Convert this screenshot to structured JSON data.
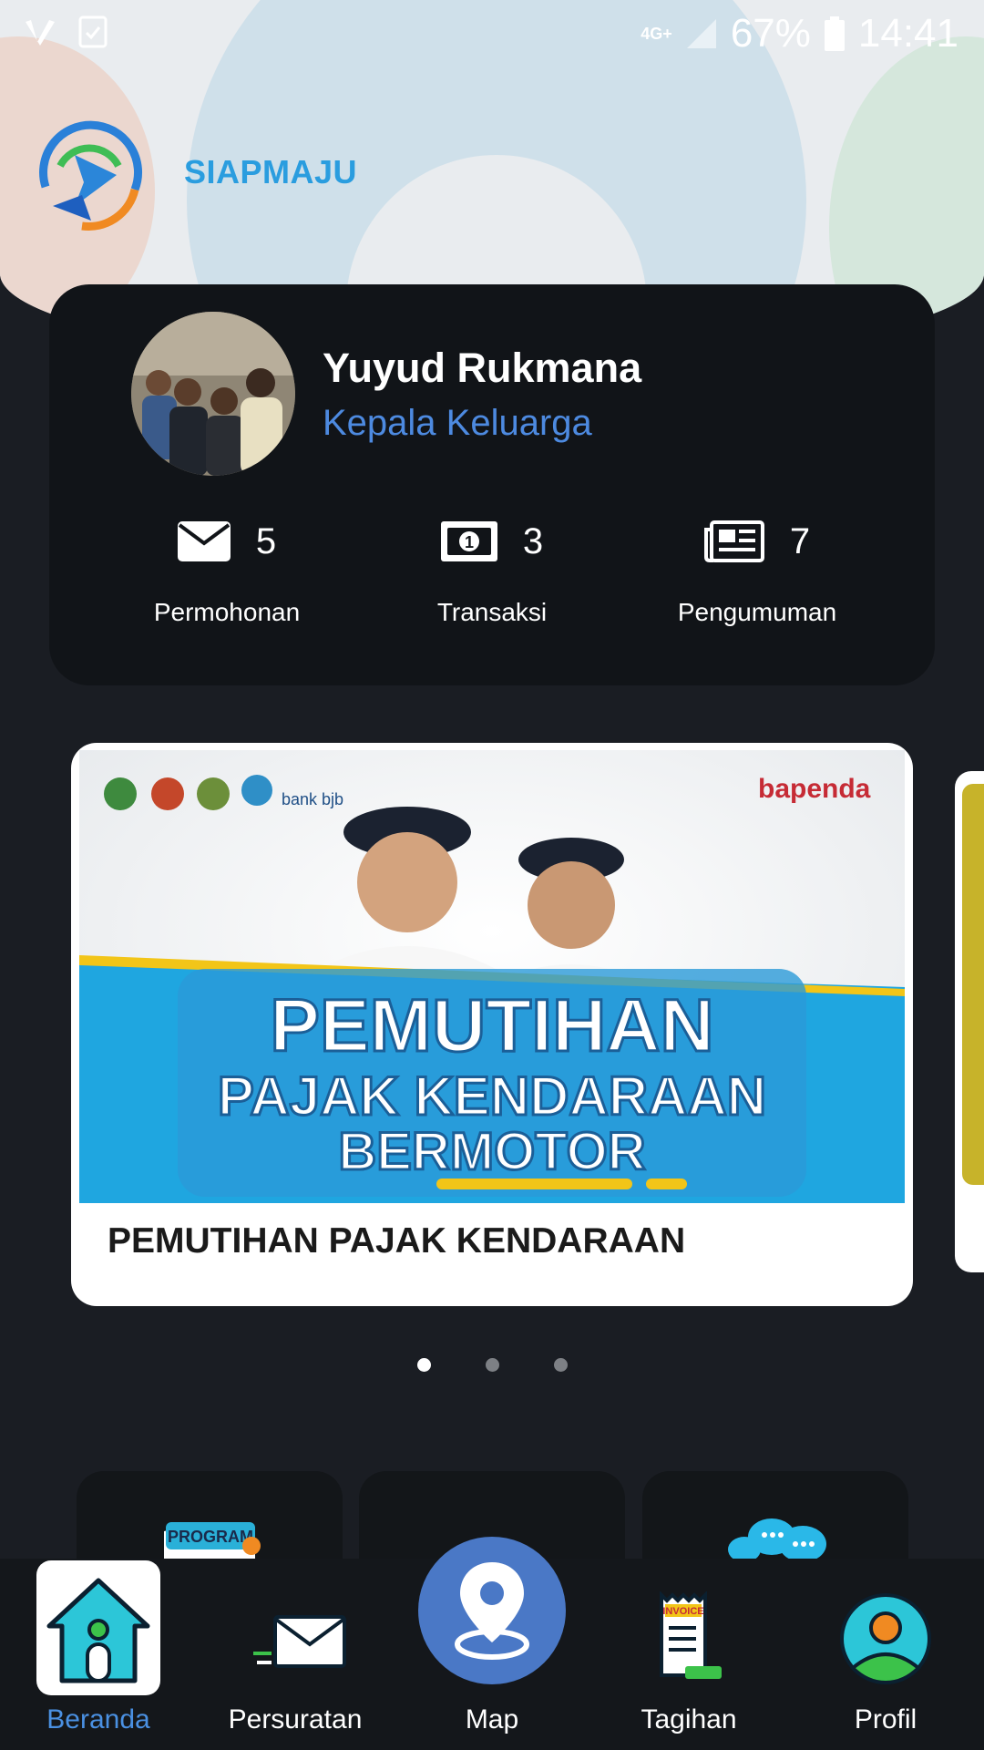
{
  "status_bar": {
    "network": "4G+",
    "battery": "67%",
    "time": "14:41"
  },
  "app": {
    "name": "SIAPMAJU"
  },
  "profile": {
    "name": "Yuyud Rukmana",
    "role": "Kepala Keluarga"
  },
  "stats": [
    {
      "icon": "envelope-icon",
      "count": "5",
      "label": "Permohonan"
    },
    {
      "icon": "money-icon",
      "count": "3",
      "label": "Transaksi"
    },
    {
      "icon": "newspaper-icon",
      "count": "7",
      "label": "Pengumuman"
    }
  ],
  "banner": {
    "headline_line1": "PEMUTIHAN",
    "headline_line2": "PAJAK KENDARAAN",
    "headline_line3": "BERMOTOR",
    "bank_text": "bank bjb",
    "brand_text": "bapenda",
    "title": "PEMUTIHAN PAJAK KENDARAAN"
  },
  "carousel": {
    "pages": 3,
    "active": 1
  },
  "menu": {
    "program_label": "PROGRAM"
  },
  "nav": {
    "items": [
      {
        "label": "Beranda",
        "active": true
      },
      {
        "label": "Persuratan",
        "active": false
      },
      {
        "label": "Map",
        "active": false
      },
      {
        "label": "Tagihan",
        "active": false
      },
      {
        "label": "Profil",
        "active": false
      }
    ],
    "invoice_text": "INVOICE"
  },
  "colors": {
    "accent": "#4a90e2",
    "card": "#111418",
    "background": "#1a1d23",
    "app_name": "#2a9ddf"
  }
}
